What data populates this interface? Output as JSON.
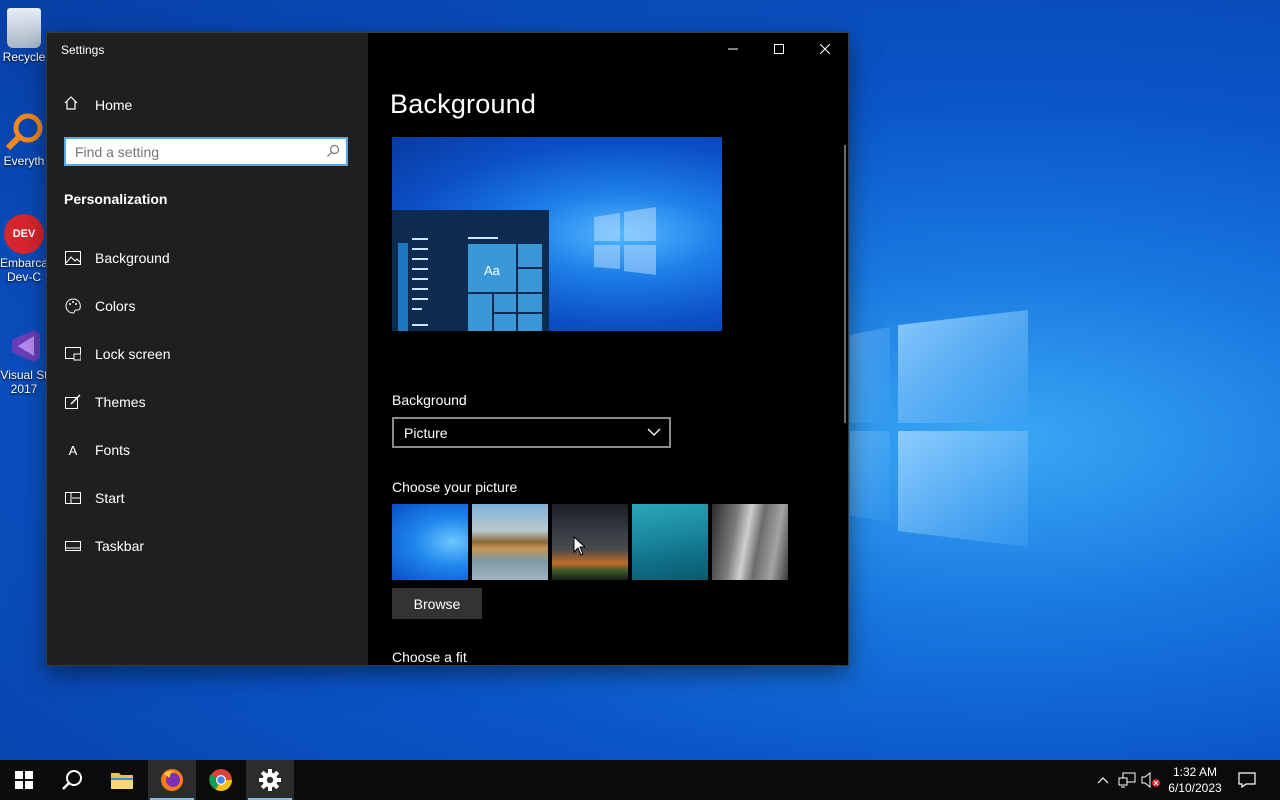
{
  "desktop": {
    "icons": [
      {
        "label": "Recycle",
        "color": "#c7d3e0"
      },
      {
        "label": "Everyth",
        "color": "#f08a1c"
      },
      {
        "label": "Embarca\nDev-C",
        "color": "#d8262f"
      },
      {
        "label": "Visual St\n2017",
        "color": "#6a3fb5"
      }
    ]
  },
  "window": {
    "title": "Settings",
    "controls": {
      "minimize": "minimize-icon",
      "maximize": "maximize-icon",
      "close": "close-icon"
    }
  },
  "sidebar": {
    "home": "Home",
    "search_placeholder": "Find a setting",
    "section": "Personalization",
    "items": [
      {
        "label": "Background",
        "icon": "picture-icon"
      },
      {
        "label": "Colors",
        "icon": "palette-icon"
      },
      {
        "label": "Lock screen",
        "icon": "lock-screen-icon"
      },
      {
        "label": "Themes",
        "icon": "themes-icon"
      },
      {
        "label": "Fonts",
        "icon": "fonts-icon"
      },
      {
        "label": "Start",
        "icon": "start-icon"
      },
      {
        "label": "Taskbar",
        "icon": "taskbar-icon"
      }
    ]
  },
  "main": {
    "heading": "Background",
    "preview_tile_text": "Aa",
    "background_label": "Background",
    "background_value": "Picture",
    "choose_picture_label": "Choose your picture",
    "browse_label": "Browse",
    "choose_fit_label": "Choose a fit"
  },
  "taskbar": {
    "apps": [
      "start-icon",
      "search-icon",
      "file-explorer-icon",
      "firefox-icon",
      "chrome-icon",
      "settings-icon"
    ],
    "time": "1:32 AM",
    "date": "6/10/2023"
  }
}
